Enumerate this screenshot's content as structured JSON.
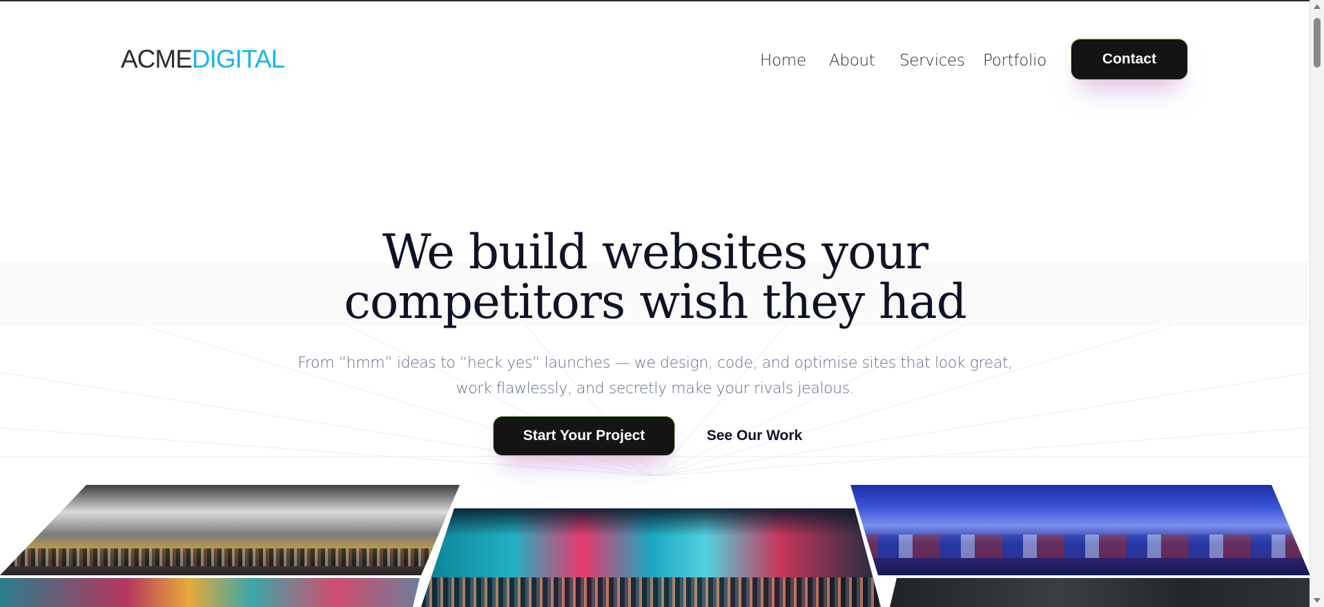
{
  "logo": {
    "part1": "ACME",
    "part2": "DIGITAL"
  },
  "nav": {
    "items": [
      "Home",
      "About",
      "Services",
      "Portfolio"
    ],
    "contact_label": "Contact"
  },
  "hero": {
    "title_line1": "We build websites your",
    "title_line2": "competitors wish they had",
    "subtitle_line1": "From “hmm” ideas to “heck yes” launches — we design, code, and optimise sites that look great,",
    "subtitle_line2": "work flawlessly, and secretly make your rivals jealous.",
    "primary_cta": "Start Your Project",
    "secondary_cta": "See Our Work"
  },
  "gallery": {
    "tiles": [
      "times-square-photo",
      "tokyo-street-night-photo",
      "tokyo-blue-street-photo",
      "neon-signs-photo",
      "dark-city-photo"
    ]
  },
  "colors": {
    "accent": "#19b5ea",
    "dark_button": "#141414",
    "title": "#0f1325",
    "subtitle": "#5f6e86"
  }
}
